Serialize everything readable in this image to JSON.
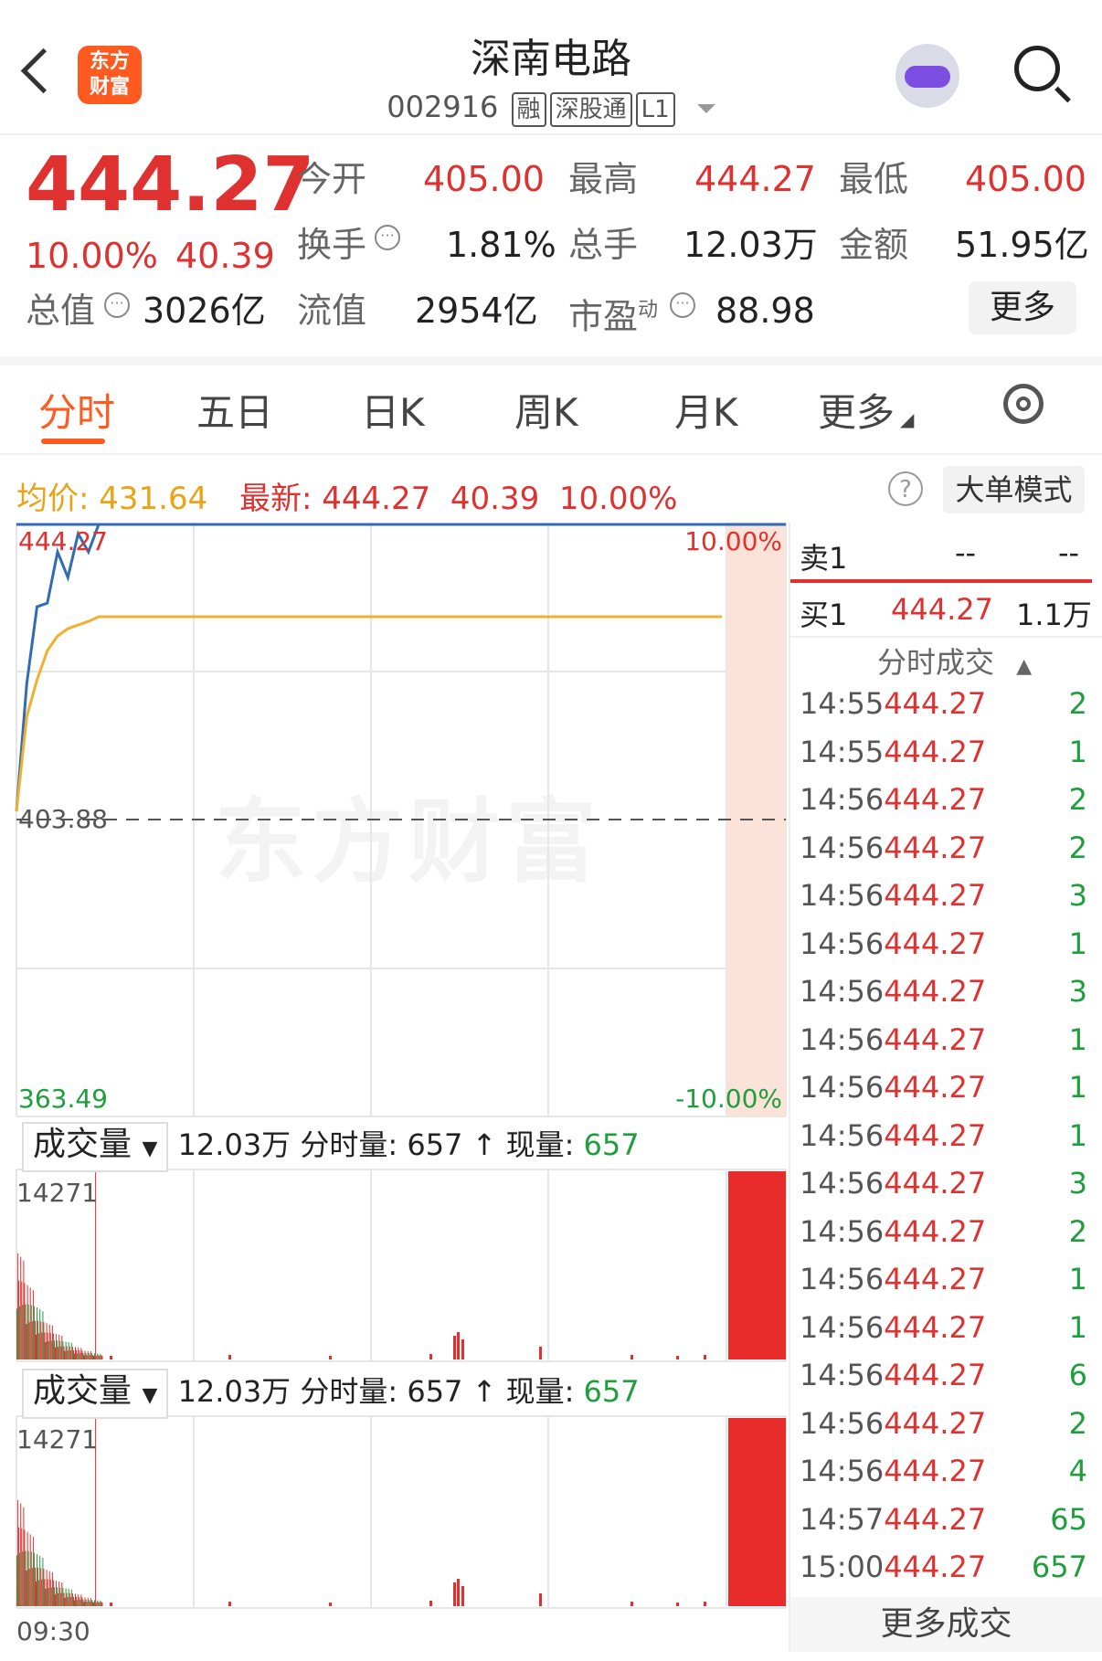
{
  "header": {
    "back_icon": "chevron-left-icon",
    "logo_line1": "东方",
    "logo_line2": "财富",
    "title": "深南电路",
    "code": "002916",
    "tags": [
      "融",
      "深股通",
      "L1"
    ],
    "assistant_icon": "robot-avatar-icon",
    "search_icon": "search-icon"
  },
  "quote": {
    "price": "444.27",
    "change_pct": "10.00%",
    "change": "40.39",
    "open_label": "今开",
    "open": "405.00",
    "high_label": "最高",
    "high": "444.27",
    "low_label": "最低",
    "low": "405.00",
    "turnover_label": "换手",
    "turnover": "1.81%",
    "volume_label": "总手",
    "volume": "12.03万",
    "amount_label": "金额",
    "amount": "51.95亿",
    "mktcap_label": "总值",
    "mktcap": "3026亿",
    "float_label": "流值",
    "float": "2954亿",
    "pe_label": "市盈",
    "pe_sup": "动",
    "pe": "88.98",
    "more": "更多"
  },
  "tabs": [
    "分时",
    "五日",
    "日K",
    "周K",
    "月K",
    "更多"
  ],
  "info": {
    "avg_label": "均价:",
    "avg": "431.64",
    "latest_label": "最新:",
    "latest": "444.27",
    "latest_chg": "40.39",
    "latest_pct": "10.00%",
    "help": "?",
    "bigorder": "大单模式"
  },
  "chart_data": {
    "type": "line",
    "watermark": "东方财富",
    "y_top": "444.27",
    "y_mid": "403.88",
    "y_bottom": "363.49",
    "pct_top": "10.00%",
    "pct_bottom": "-10.00%",
    "ylim": [
      363.49,
      444.27
    ],
    "prev_close": 403.88,
    "series": [
      {
        "values": [
          405.0,
          425.0,
          430.5,
          436.0,
          438.0,
          439.5,
          440.5,
          443.0,
          444.27
        ]
      },
      {
        "values": [
          405.0,
          418.0,
          423.0,
          427.0,
          429.0,
          430.0,
          430.5,
          431.0,
          431.64
        ]
      }
    ],
    "x_start": "09:30"
  },
  "volume": {
    "selector": "成交量",
    "total": "12.03万",
    "period_label": "分时量:",
    "period": "657",
    "now_label": "现量:",
    "now": "657",
    "max": "14271"
  },
  "orderbook": {
    "sell_label": "卖1",
    "sell_price": "--",
    "sell_vol": "--",
    "buy_label": "买1",
    "buy_price": "444.27",
    "buy_vol": "1.1万",
    "trades_title": "分时成交",
    "trades": [
      {
        "t": "14:55",
        "p": "444.27",
        "v": "2"
      },
      {
        "t": "14:55",
        "p": "444.27",
        "v": "1"
      },
      {
        "t": "14:56",
        "p": "444.27",
        "v": "2"
      },
      {
        "t": "14:56",
        "p": "444.27",
        "v": "2"
      },
      {
        "t": "14:56",
        "p": "444.27",
        "v": "3"
      },
      {
        "t": "14:56",
        "p": "444.27",
        "v": "1"
      },
      {
        "t": "14:56",
        "p": "444.27",
        "v": "3"
      },
      {
        "t": "14:56",
        "p": "444.27",
        "v": "1"
      },
      {
        "t": "14:56",
        "p": "444.27",
        "v": "1"
      },
      {
        "t": "14:56",
        "p": "444.27",
        "v": "1"
      },
      {
        "t": "14:56",
        "p": "444.27",
        "v": "3"
      },
      {
        "t": "14:56",
        "p": "444.27",
        "v": "2"
      },
      {
        "t": "14:56",
        "p": "444.27",
        "v": "1"
      },
      {
        "t": "14:56",
        "p": "444.27",
        "v": "1"
      },
      {
        "t": "14:56",
        "p": "444.27",
        "v": "6"
      },
      {
        "t": "14:56",
        "p": "444.27",
        "v": "2"
      },
      {
        "t": "14:56",
        "p": "444.27",
        "v": "4"
      },
      {
        "t": "14:57",
        "p": "444.27",
        "v": "65"
      },
      {
        "t": "15:00",
        "p": "444.27",
        "v": "657"
      }
    ],
    "more": "更多成交"
  }
}
